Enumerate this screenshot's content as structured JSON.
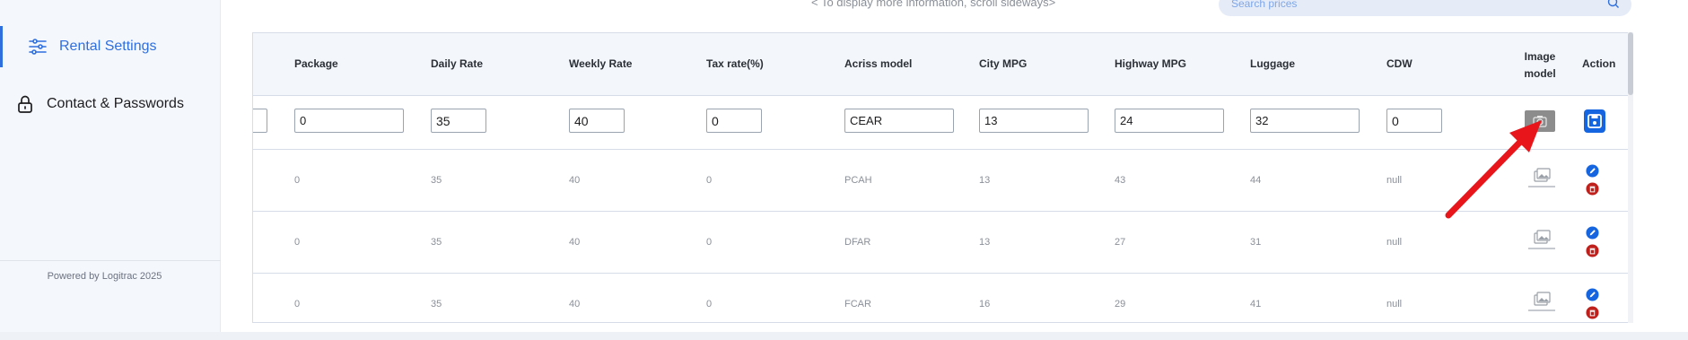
{
  "sidebar": {
    "items": [
      {
        "label": "Rental Settings",
        "icon": "sliders-icon",
        "active": true
      },
      {
        "label": "Contact & Passwords",
        "icon": "lock-icon",
        "active": false
      }
    ],
    "footer": "Powered by Logitrac 2025"
  },
  "header": {
    "scroll_hint": "< To display more information, scroll sideways>",
    "search_placeholder": "Search prices"
  },
  "table": {
    "columns": [
      "Package",
      "Daily Rate",
      "Weekly Rate",
      "Tax rate(%)",
      "Acriss model",
      "City MPG",
      "Highway MPG",
      "Luggage",
      "CDW",
      "Image model",
      "Action"
    ],
    "edit_row": {
      "package": "0",
      "daily_rate": "35",
      "weekly_rate": "40",
      "tax_rate": "0",
      "acriss_model": "CEAR",
      "city_mpg": "13",
      "highway_mpg": "24",
      "luggage": "32",
      "cdw": "0"
    },
    "rows": [
      {
        "package": "0",
        "daily_rate": "35",
        "weekly_rate": "40",
        "tax_rate": "0",
        "acriss_model": "PCAH",
        "city_mpg": "13",
        "highway_mpg": "43",
        "luggage": "44",
        "cdw": "null"
      },
      {
        "package": "0",
        "daily_rate": "35",
        "weekly_rate": "40",
        "tax_rate": "0",
        "acriss_model": "DFAR",
        "city_mpg": "13",
        "highway_mpg": "27",
        "luggage": "31",
        "cdw": "null"
      },
      {
        "package": "0",
        "daily_rate": "35",
        "weekly_rate": "40",
        "tax_rate": "0",
        "acriss_model": "FCAR",
        "city_mpg": "16",
        "highway_mpg": "29",
        "luggage": "41",
        "cdw": "null"
      }
    ]
  },
  "colors": {
    "accent": "#2f6fdd",
    "save": "#1565e0",
    "delete": "#c0201c",
    "annotation_arrow": "#e8161b"
  }
}
